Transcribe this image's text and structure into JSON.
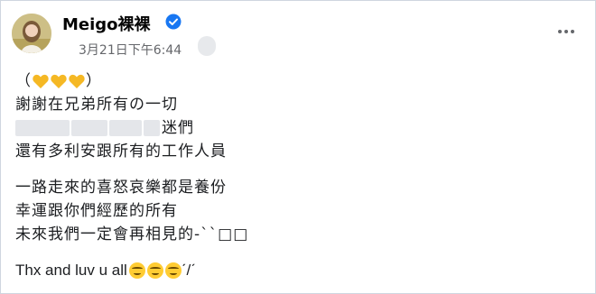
{
  "post": {
    "author_name": "Meigo裸裸",
    "timestamp": "3月21日下午6:44",
    "lines": {
      "l1_open": "（",
      "l1_close": "）",
      "l2": "謝謝在兄弟所有の一切",
      "l3": "迷們",
      "l4": "還有多利安跟所有的工作人員",
      "l5": "一路走來的喜怒哀樂都是養份",
      "l6": "幸運跟你們經歷的所有",
      "l7": "未來我們一定會再相見的-ˋˋ□□",
      "l8": "Thx  and luv u all",
      "l8_tail": "ˊ/ˊ"
    }
  },
  "icons": {
    "avatar": "avatar",
    "verified": "verified-badge-icon",
    "more": "more-options-icon",
    "heart": "yellow-heart-icon",
    "smile": "smiling-face-icon"
  },
  "colors": {
    "verified_blue": "#1877f2",
    "heart_yellow": "#f5b824",
    "muted_text": "#65676b"
  }
}
